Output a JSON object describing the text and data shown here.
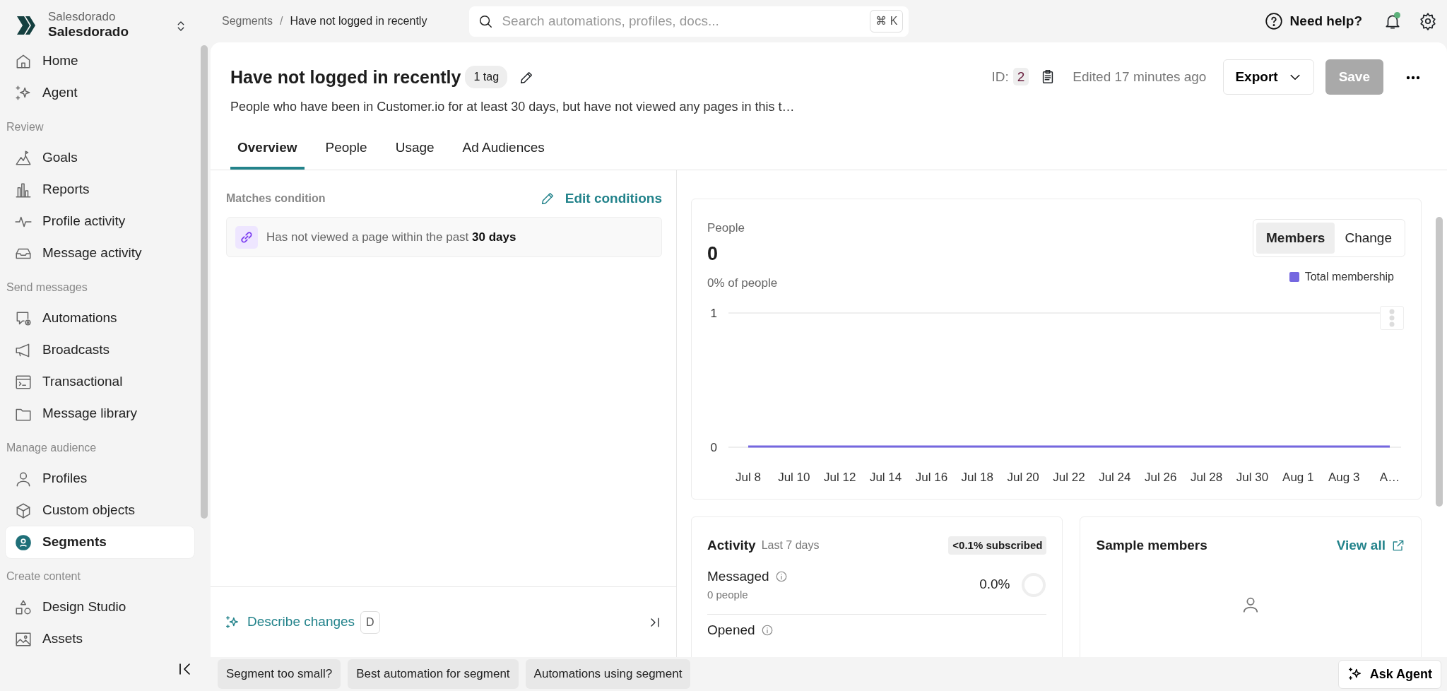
{
  "sidebar": {
    "workspace": {
      "label": "Salesdorado",
      "name": "Salesdorado"
    },
    "sections": [
      {
        "items": [
          {
            "label": "Home",
            "kind": "home",
            "selected": false
          },
          {
            "label": "Agent",
            "kind": "sparkle",
            "selected": false
          }
        ]
      },
      {
        "title": "Review",
        "items": [
          {
            "label": "Goals",
            "kind": "goal",
            "selected": false
          },
          {
            "label": "Reports",
            "kind": "bars",
            "selected": false
          },
          {
            "label": "Profile activity",
            "kind": "pulse",
            "selected": false
          },
          {
            "label": "Message activity",
            "kind": "inbox",
            "selected": false
          }
        ]
      },
      {
        "title": "Send messages",
        "items": [
          {
            "label": "Automations",
            "kind": "automation",
            "selected": false
          },
          {
            "label": "Broadcasts",
            "kind": "megaphone",
            "selected": false
          },
          {
            "label": "Transactional",
            "kind": "terminal",
            "selected": false
          },
          {
            "label": "Message library",
            "kind": "folder",
            "selected": false
          }
        ]
      },
      {
        "title": "Manage audience",
        "items": [
          {
            "label": "Profiles",
            "kind": "person",
            "selected": false
          },
          {
            "label": "Custom objects",
            "kind": "cube",
            "selected": false
          },
          {
            "label": "Segments",
            "kind": "segment",
            "selected": true
          }
        ]
      },
      {
        "title": "Create content",
        "items": [
          {
            "label": "Design Studio",
            "kind": "shapes",
            "selected": false
          },
          {
            "label": "Assets",
            "kind": "image",
            "selected": false
          }
        ]
      }
    ]
  },
  "topbar": {
    "separator": "/",
    "breadcrumb": [
      {
        "label": "Segments"
      },
      {
        "label": "Have not logged in recently"
      }
    ],
    "search": {
      "placeholder": "Search automations, profiles, docs...",
      "shortcut": "⌘ K"
    },
    "help": "Need help?",
    "notifications": {
      "unread": true
    }
  },
  "header": {
    "title": "Have not logged in recently",
    "tag": "1 tag",
    "description": "People who have been in Customer.io for at least 30 days, but have not viewed any pages in this t…",
    "id_label": "ID:",
    "id": "2",
    "edited": "Edited 17 minutes ago",
    "export": "Export",
    "save": {
      "label": "Save",
      "disabled": true
    }
  },
  "tabs": [
    {
      "label": "Overview",
      "selected": true
    },
    {
      "label": "People",
      "selected": false
    },
    {
      "label": "Usage",
      "selected": false
    },
    {
      "label": "Ad Audiences",
      "selected": false
    }
  ],
  "conditions": {
    "heading": "Matches condition",
    "edit": "Edit conditions",
    "items": [
      "Has not viewed a page within the past **30 days**"
    ]
  },
  "describe": {
    "label": "Describe changes",
    "shortcut": "D"
  },
  "people_card": {
    "label": "People",
    "value": "0",
    "share": "0% of people",
    "toggle": [
      {
        "label": "Members",
        "selected": true
      },
      {
        "label": "Change",
        "selected": false
      }
    ],
    "chart_data": {
      "type": "line",
      "categories": [
        "Jul 8",
        "Jul 10",
        "Jul 12",
        "Jul 14",
        "Jul 16",
        "Jul 18",
        "Jul 20",
        "Jul 22",
        "Jul 24",
        "Jul 26",
        "Jul 28",
        "Jul 30",
        "Aug 1",
        "Aug 3",
        "A…"
      ],
      "series": [
        {
          "name": "Total membership",
          "color": "#7467e0",
          "values": [
            0,
            0,
            0,
            0,
            0,
            0,
            0,
            0,
            0,
            0,
            0,
            0,
            0,
            0,
            0
          ]
        }
      ],
      "ylim": [
        0,
        1
      ],
      "yticks": [
        0,
        1
      ]
    }
  },
  "activity": {
    "title": "Activity",
    "period": "Last 7 days",
    "badge": "<0.1% subscribed",
    "metrics": [
      {
        "label": "Messaged",
        "count": "0 people",
        "rate": "0.0%"
      }
    ],
    "next_label": "Opened"
  },
  "sample_members": {
    "title": "Sample members",
    "link": "View all"
  },
  "suggestions": [
    "Segment too small?",
    "Best automation for segment",
    "Automations using segment"
  ],
  "ask_agent": "Ask Agent"
}
